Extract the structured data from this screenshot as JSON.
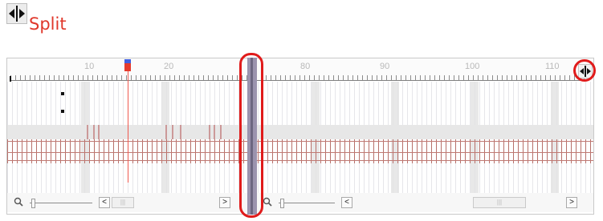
{
  "header": {
    "icon_name": "split-arrows-icon",
    "label": "Split",
    "label_color": "#e0382b"
  },
  "timeline": {
    "left_ruler_labels": [
      "10",
      "20"
    ],
    "right_ruler_labels": [
      "80",
      "90",
      "100",
      "110"
    ],
    "playhead_color": "#e53a2c",
    "highlight_color": "#e01b1b",
    "left_nav": {
      "prev_label": "<",
      "next_label": ">",
      "thumb_label": "|||"
    },
    "right_nav": {
      "prev_label": "<",
      "next_label": ">",
      "thumb_label": "|||"
    }
  }
}
